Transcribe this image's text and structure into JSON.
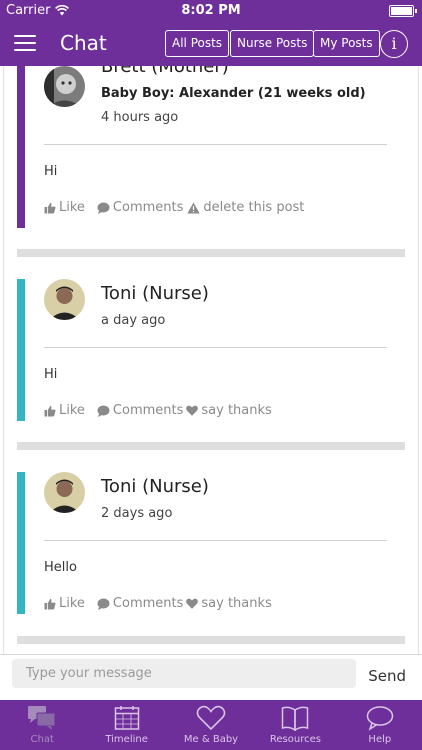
{
  "status_bar": {
    "carrier": "Carrier",
    "time": "8:02 PM"
  },
  "nav": {
    "title": "Chat",
    "filters": [
      "All Posts",
      "Nurse Posts",
      "My Posts"
    ],
    "info_glyph": "i"
  },
  "posts": [
    {
      "author": "Brett (Mother)",
      "baby": "Baby Boy: Alexander (21 weeks old)",
      "time": "4 hours ago",
      "message": "Hi",
      "bar_color": "#6f2f9b",
      "like": "Like",
      "comments": "Comments",
      "extra_action": "delete this post",
      "extra_icon": "warning-icon"
    },
    {
      "author": "Toni (Nurse)",
      "time": "a day ago",
      "message": "Hi",
      "bar_color": "#33b5c2",
      "like": "Like",
      "comments": "Comments",
      "extra_action": "say thanks",
      "extra_icon": "heart-icon"
    },
    {
      "author": "Toni (Nurse)",
      "time": "2 days ago",
      "message": "Hello",
      "bar_color": "#33b5c2",
      "like": "Like",
      "comments": "Comments",
      "extra_action": "say thanks",
      "extra_icon": "heart-icon"
    }
  ],
  "composer": {
    "placeholder": "Type your message",
    "send": "Send"
  },
  "tabs": [
    {
      "label": "Chat",
      "icon": "chat-bubbles-icon",
      "active": true
    },
    {
      "label": "Timeline",
      "icon": "calendar-icon",
      "active": false
    },
    {
      "label": "Me & Baby",
      "icon": "heart-icon",
      "active": false
    },
    {
      "label": "Resources",
      "icon": "book-icon",
      "active": false
    },
    {
      "label": "Help",
      "icon": "speech-bubble-icon",
      "active": false
    }
  ],
  "colors": {
    "brand": "#6f2f9b",
    "nurse_accent": "#33b5c2",
    "mother_accent": "#6f2f9b"
  }
}
